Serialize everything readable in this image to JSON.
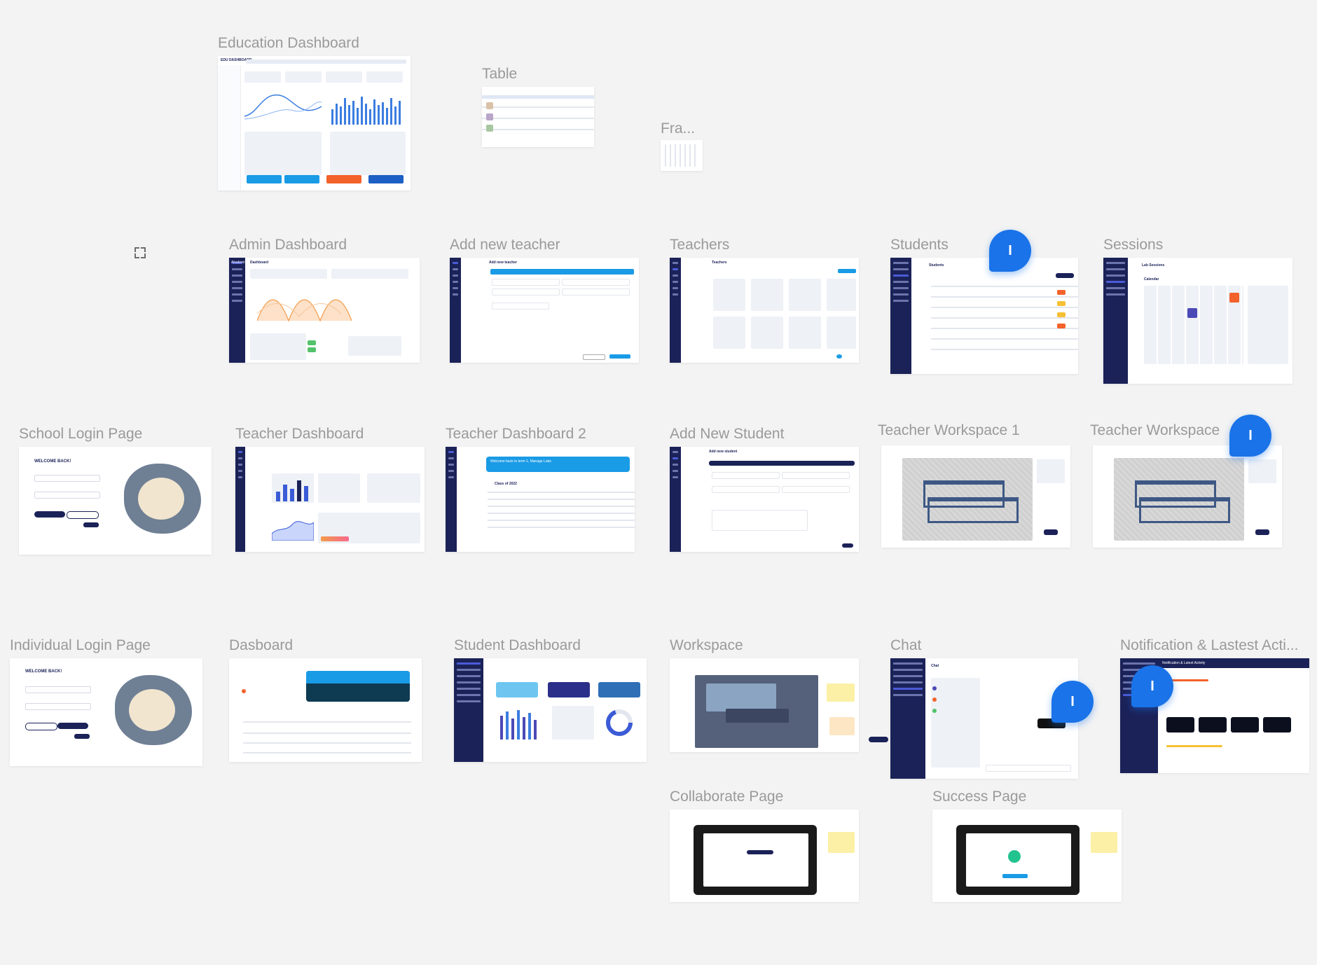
{
  "frames": [
    {
      "id": "education-dashboard",
      "title": "Education Dashboard"
    },
    {
      "id": "table",
      "title": "Table"
    },
    {
      "id": "fra",
      "title": "Fra..."
    },
    {
      "id": "admin-dashboard",
      "title": "Admin Dashboard"
    },
    {
      "id": "add-new-teacher",
      "title": "Add new teacher"
    },
    {
      "id": "teachers",
      "title": "Teachers"
    },
    {
      "id": "students",
      "title": "Students"
    },
    {
      "id": "sessions",
      "title": "Sessions"
    },
    {
      "id": "school-login",
      "title": "School Login Page"
    },
    {
      "id": "teacher-dashboard",
      "title": "Teacher Dashboard"
    },
    {
      "id": "teacher-dashboard-2",
      "title": "Teacher Dashboard 2"
    },
    {
      "id": "add-new-student",
      "title": "Add New Student"
    },
    {
      "id": "teacher-workspace-1",
      "title": "Teacher Workspace 1"
    },
    {
      "id": "teacher-workspace",
      "title": "Teacher Workspace"
    },
    {
      "id": "individual-login",
      "title": "Individual Login Page"
    },
    {
      "id": "dasboard",
      "title": "Dasboard"
    },
    {
      "id": "student-dashboard",
      "title": "Student Dashboard"
    },
    {
      "id": "workspace",
      "title": "Workspace"
    },
    {
      "id": "chat",
      "title": "Chat"
    },
    {
      "id": "notification",
      "title": "Notification & Lastest Acti..."
    },
    {
      "id": "collaborate",
      "title": "Collaborate Page"
    },
    {
      "id": "success",
      "title": "Success Page"
    }
  ],
  "comment_pins": [
    {
      "label": "I"
    },
    {
      "label": "I"
    },
    {
      "label": "I"
    },
    {
      "label": "I"
    }
  ],
  "frame_text": {
    "edu_brand": "EDU DASHBOARD",
    "akademi": "Akademi",
    "admin_header": "Dashboard",
    "teacher_form_header": "Add new teacher",
    "teachers_header": "Teachers",
    "students_header": "Students",
    "sessions_header": "Lab Sessions",
    "calendar": "Calendar",
    "welcome_back": "WELCOME BACK!",
    "add_student_header": "Add new student",
    "welcome_banner": "Welcome back to term 1, Manage Labs",
    "class_label": "Class of 2022",
    "chat_header": "Chat",
    "notification_header": "Notification & Latest Activity"
  },
  "colors": {
    "canvas": "#f3f3f3",
    "sidebar": "#1b2258",
    "accent": "#1a9be6",
    "pin": "#1a73e8",
    "label": "#9a9a9a"
  }
}
